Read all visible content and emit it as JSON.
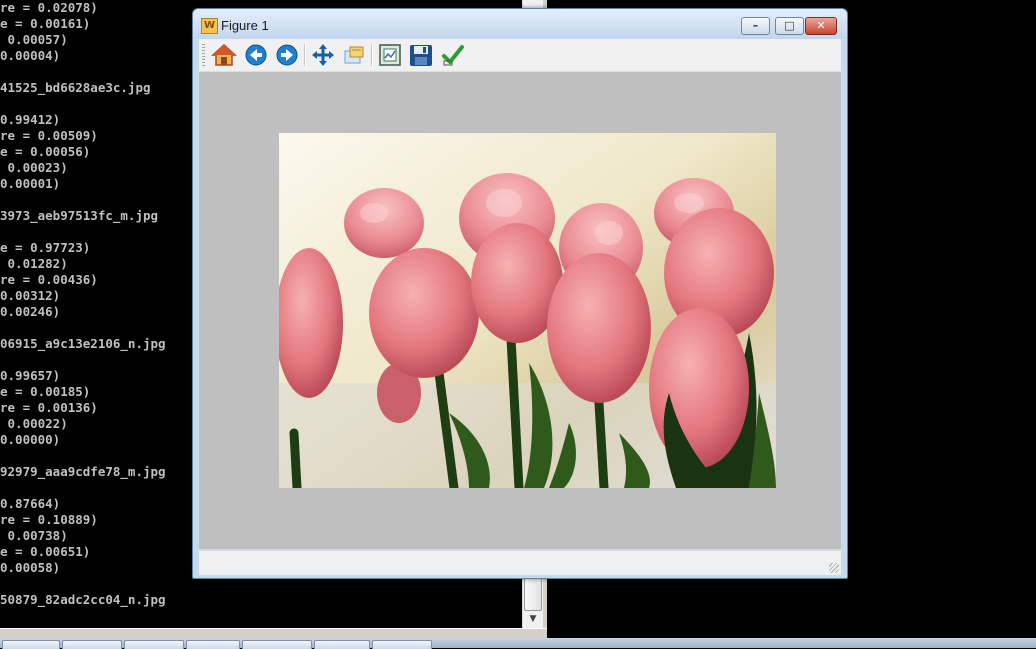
{
  "console": {
    "lines": [
      "re = 0.02078)",
      "e = 0.00161)",
      " 0.00057)",
      "0.00004)",
      "",
      "41525_bd6628ae3c.jpg",
      "",
      "0.99412)",
      "re = 0.00509)",
      "e = 0.00056)",
      " 0.00023)",
      "0.00001)",
      "",
      "3973_aeb97513fc_m.jpg",
      "",
      "e = 0.97723)",
      " 0.01282)",
      "re = 0.00436)",
      "0.00312)",
      "0.00246)",
      "",
      "06915_a9c13e2106_n.jpg",
      "",
      "0.99657)",
      "e = 0.00185)",
      "re = 0.00136)",
      " 0.00022)",
      "0.00000)",
      "",
      "92979_aaa9cdfe78_m.jpg",
      "",
      "0.87664)",
      "re = 0.10889)",
      " 0.00738)",
      "e = 0.00651)",
      "0.00058)",
      "",
      "50879_82adc2cc04_n.jpg"
    ]
  },
  "figure": {
    "title": "Figure 1",
    "app_icon_glyph": "W",
    "window_buttons": {
      "minimize": "–",
      "maximize": "□",
      "close": "✕"
    },
    "toolbar": [
      {
        "name": "home-icon",
        "color": "#d6562b"
      },
      {
        "name": "back-arrow-icon",
        "color": "#1f7fd0"
      },
      {
        "name": "forward-arrow-icon",
        "color": "#1f7fd0"
      },
      {
        "name": "pan-icon",
        "color": "#1560a8"
      },
      {
        "name": "zoom-icon",
        "color": "#6aa0d8"
      },
      {
        "name": "subplots-icon",
        "color": "#3a7a5a"
      },
      {
        "name": "save-icon",
        "color": "#1d4f8c"
      },
      {
        "name": "checkmark-icon",
        "color": "#2e9c2e"
      }
    ],
    "image": {
      "subject": "pink tulips",
      "colors": {
        "petal": "#e8838a",
        "leaf": "#2f5a1c",
        "background": "#f2efe2"
      }
    },
    "status_text": ""
  }
}
